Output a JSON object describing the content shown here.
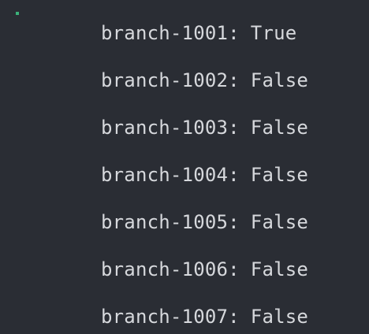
{
  "terminal": {
    "marker_color": "#3bb27a",
    "lines": [
      {
        "key": "branch-1001:",
        "value": "True"
      },
      {
        "key": "branch-1002:",
        "value": "False"
      },
      {
        "key": "branch-1003:",
        "value": "False"
      },
      {
        "key": "branch-1004:",
        "value": "False"
      },
      {
        "key": "branch-1005:",
        "value": "False"
      },
      {
        "key": "branch-1006:",
        "value": "False"
      },
      {
        "key": "branch-1007:",
        "value": "False"
      }
    ]
  }
}
